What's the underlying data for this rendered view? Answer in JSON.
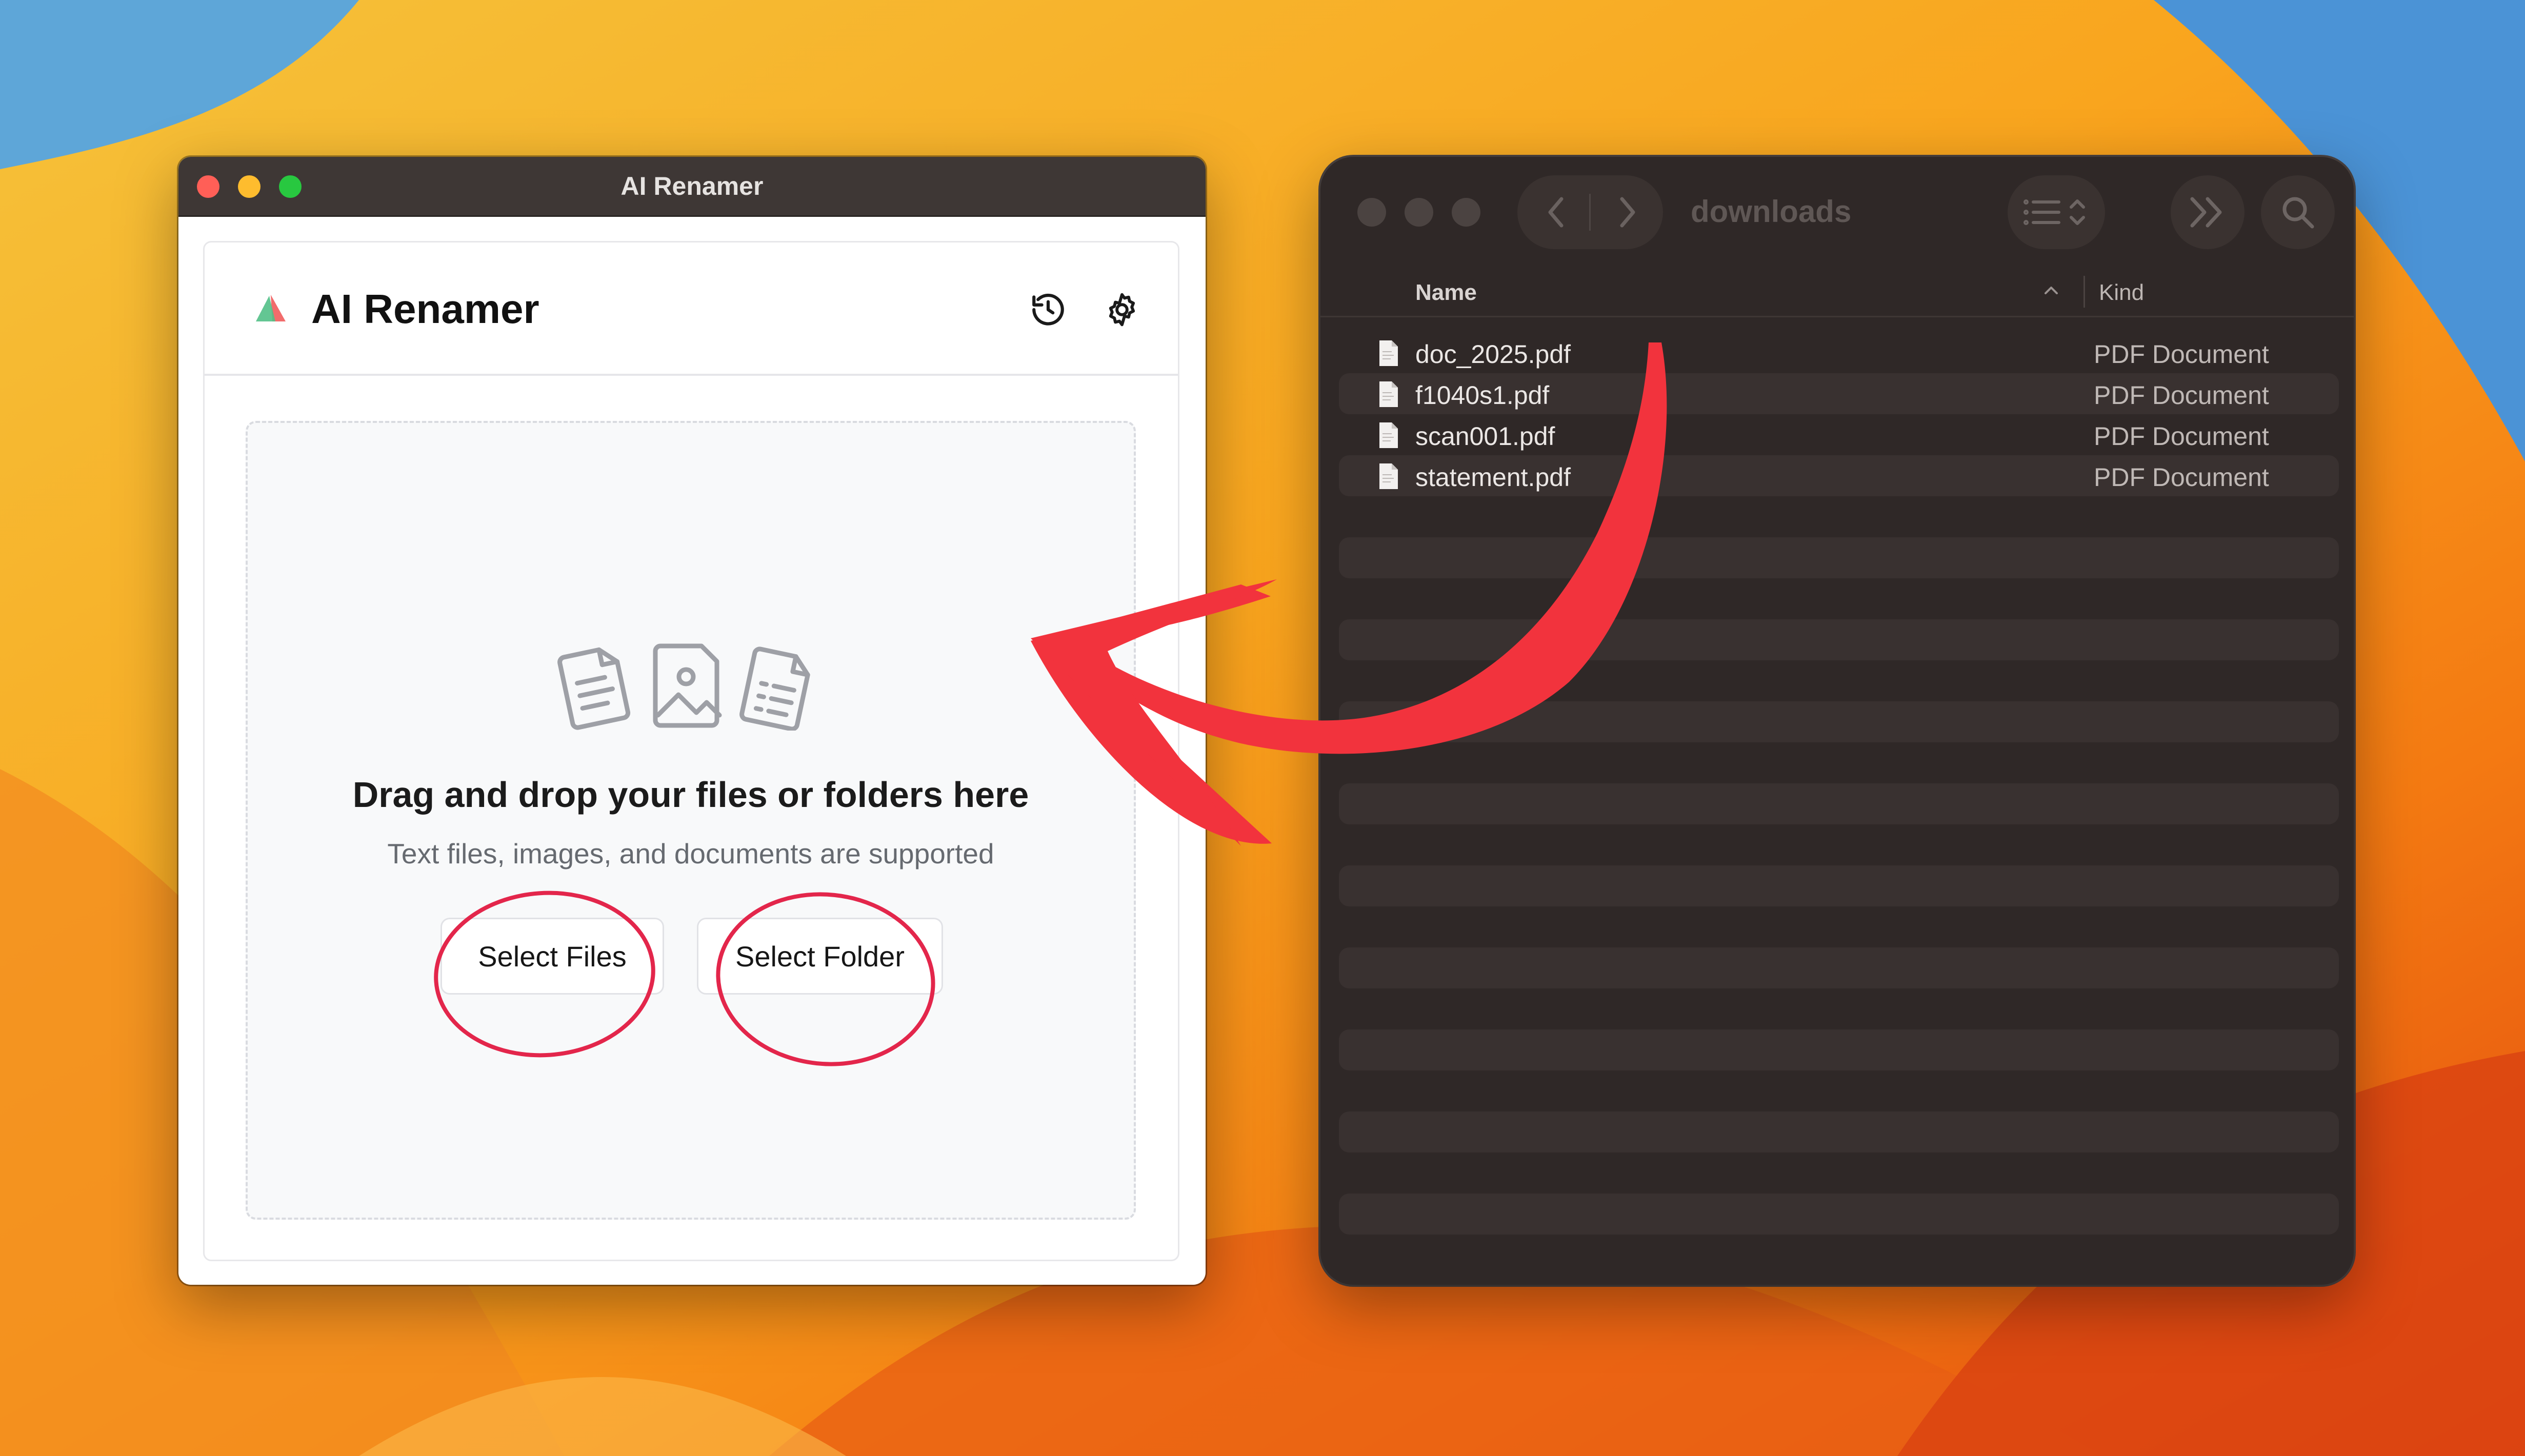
{
  "left_window": {
    "title": "AI Renamer",
    "app_title": "AI Renamer",
    "dropzone": {
      "title": "Drag and drop your files or folders here",
      "subtitle": "Text files, images, and documents are supported"
    },
    "buttons": {
      "select_files": "Select Files",
      "select_folder": "Select Folder"
    },
    "icons": [
      "logo-icon",
      "history-icon",
      "settings-icon",
      "document-text-icon",
      "image-file-icon",
      "document-list-icon"
    ]
  },
  "finder": {
    "location": "downloads",
    "columns": {
      "name": "Name",
      "kind": "Kind"
    },
    "files": [
      {
        "name": "doc_2025.pdf",
        "kind": "PDF Document"
      },
      {
        "name": "f1040s1.pdf",
        "kind": "PDF Document"
      },
      {
        "name": "scan001.pdf",
        "kind": "PDF Document"
      },
      {
        "name": "statement.pdf",
        "kind": "PDF Document"
      }
    ],
    "icons": [
      "back-icon",
      "forward-icon",
      "list-view-icon",
      "more-toolbar-icon",
      "search-icon",
      "pdf-file-icon"
    ]
  },
  "annotations": {
    "arrow_color": "#f2333d",
    "circle_color": "#e3264b"
  },
  "colors": {
    "accent_green": "#34c759",
    "accent_red": "#ff5f57"
  }
}
